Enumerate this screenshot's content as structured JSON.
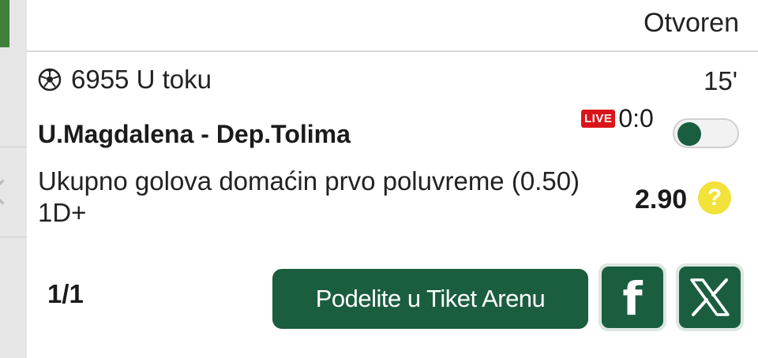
{
  "ticket": {
    "status": "Otvoren",
    "event_id_status": "6955 U toku",
    "minute": "15'",
    "teams": "U.Magdalena - Dep.Tolima",
    "live_label": "LIVE",
    "score": "0:0",
    "market": "Ukupno golova domaćin prvo poluvreme (0.50) 1D+",
    "odds": "2.90",
    "help_symbol": "?",
    "count": "1/1",
    "share_label": "Podelite u Tiket Arenu",
    "facebook_label": "f",
    "toggle_on": false
  },
  "colors": {
    "brand_green": "#1b5e3f",
    "live_red": "#d9151b",
    "help_yellow": "#f2e23a"
  },
  "icons": [
    "soccer-ball-icon",
    "live-icon",
    "help-icon",
    "facebook-icon",
    "x-icon"
  ]
}
